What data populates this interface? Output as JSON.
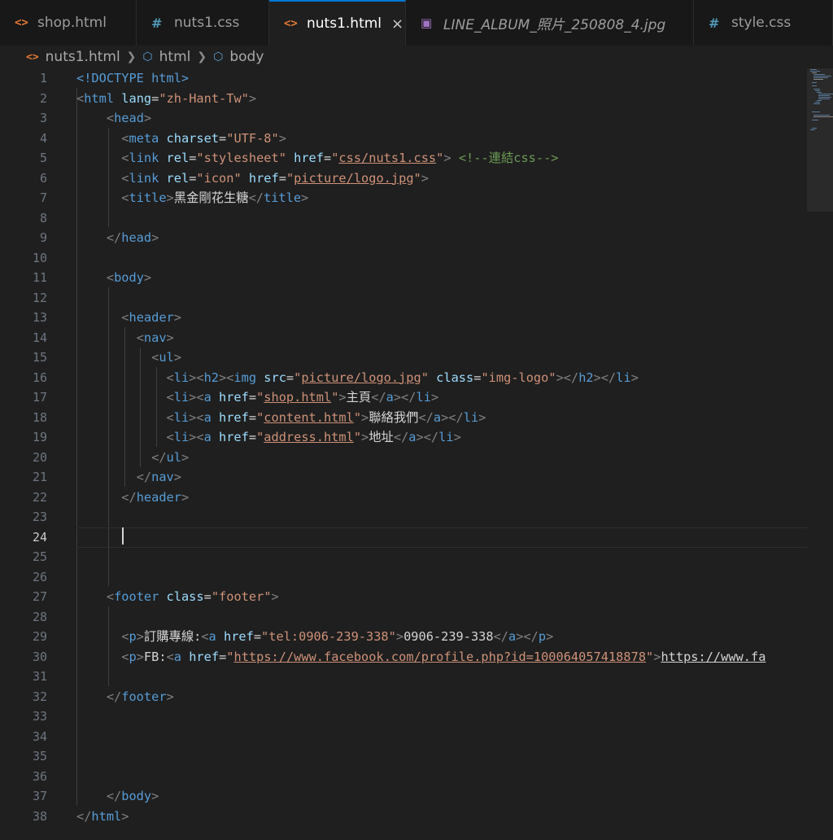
{
  "tabs": [
    {
      "label": "shop.html",
      "icon": "html-file-icon",
      "active": false
    },
    {
      "label": "nuts1.css",
      "icon": "css-file-icon",
      "active": false
    },
    {
      "label": "nuts1.html",
      "icon": "html-file-icon",
      "active": true,
      "close": "×"
    },
    {
      "label": "LINE_ALBUM_照片_250808_4.jpg",
      "icon": "image-file-icon",
      "active": false
    },
    {
      "label": "style.css",
      "icon": "css-file-icon",
      "active": false
    }
  ],
  "breadcrumb": {
    "file": "nuts1.html",
    "node1": "html",
    "node2": "body"
  },
  "editor": {
    "active_line": 24,
    "line_numbers": [
      "1",
      "2",
      "3",
      "4",
      "5",
      "6",
      "7",
      "8",
      "9",
      "10",
      "11",
      "12",
      "13",
      "14",
      "15",
      "16",
      "17",
      "18",
      "19",
      "20",
      "21",
      "22",
      "23",
      "24",
      "25",
      "26",
      "27",
      "28",
      "29",
      "30",
      "31",
      "32",
      "33",
      "34",
      "35",
      "36",
      "37",
      "38"
    ],
    "text": {
      "doctype": "<!DOCTYPE html>",
      "lang": "zh-Hant-Tw",
      "charset": "UTF-8",
      "css_href": "css/nuts1.css",
      "comment": "<!--連結css-->",
      "icon_href": "picture/logo.jpg",
      "title": "黑金剛花生糖",
      "logo_src": "picture/logo.jpg",
      "logo_class": "img-logo",
      "nav1_href": "shop.html",
      "nav1_text": "主頁",
      "nav2_href": "content.html",
      "nav2_text": "聯絡我們",
      "nav3_href": "address.html",
      "nav3_text": "地址",
      "footer_class": "footer",
      "order_label": "訂購專線:",
      "tel_href": "tel:0906-239-338",
      "tel_text": "0906-239-338",
      "fb_label": "FB:",
      "fb_href": "https://www.facebook.com/profile.php?id=100064057418878",
      "fb_text": "https://www.fa"
    }
  }
}
